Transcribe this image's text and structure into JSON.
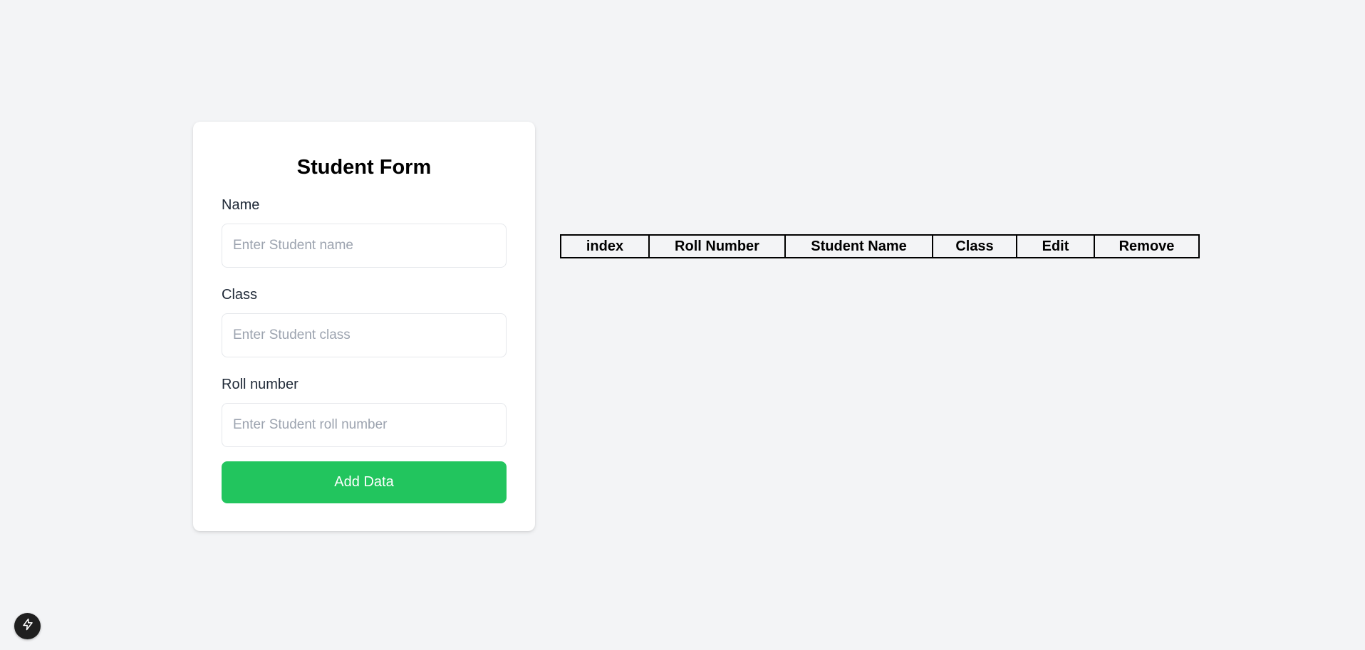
{
  "form": {
    "title": "Student Form",
    "name_label": "Name",
    "name_placeholder": "Enter Student name",
    "name_value": "",
    "class_label": "Class",
    "class_placeholder": "Enter Student class",
    "class_value": "",
    "roll_label": "Roll number",
    "roll_placeholder": "Enter Student roll number",
    "roll_value": "",
    "submit_label": "Add Data"
  },
  "table": {
    "headers": [
      "index",
      "Roll Number",
      "Student Name",
      "Class",
      "Edit",
      "Remove"
    ],
    "rows": []
  },
  "dev_badge": {
    "icon": "lightning-bolt-icon"
  },
  "colors": {
    "page_background": "#f3f4f6",
    "card_background": "#ffffff",
    "button_accent": "#22c55e",
    "badge_background": "#1f1f1f"
  }
}
